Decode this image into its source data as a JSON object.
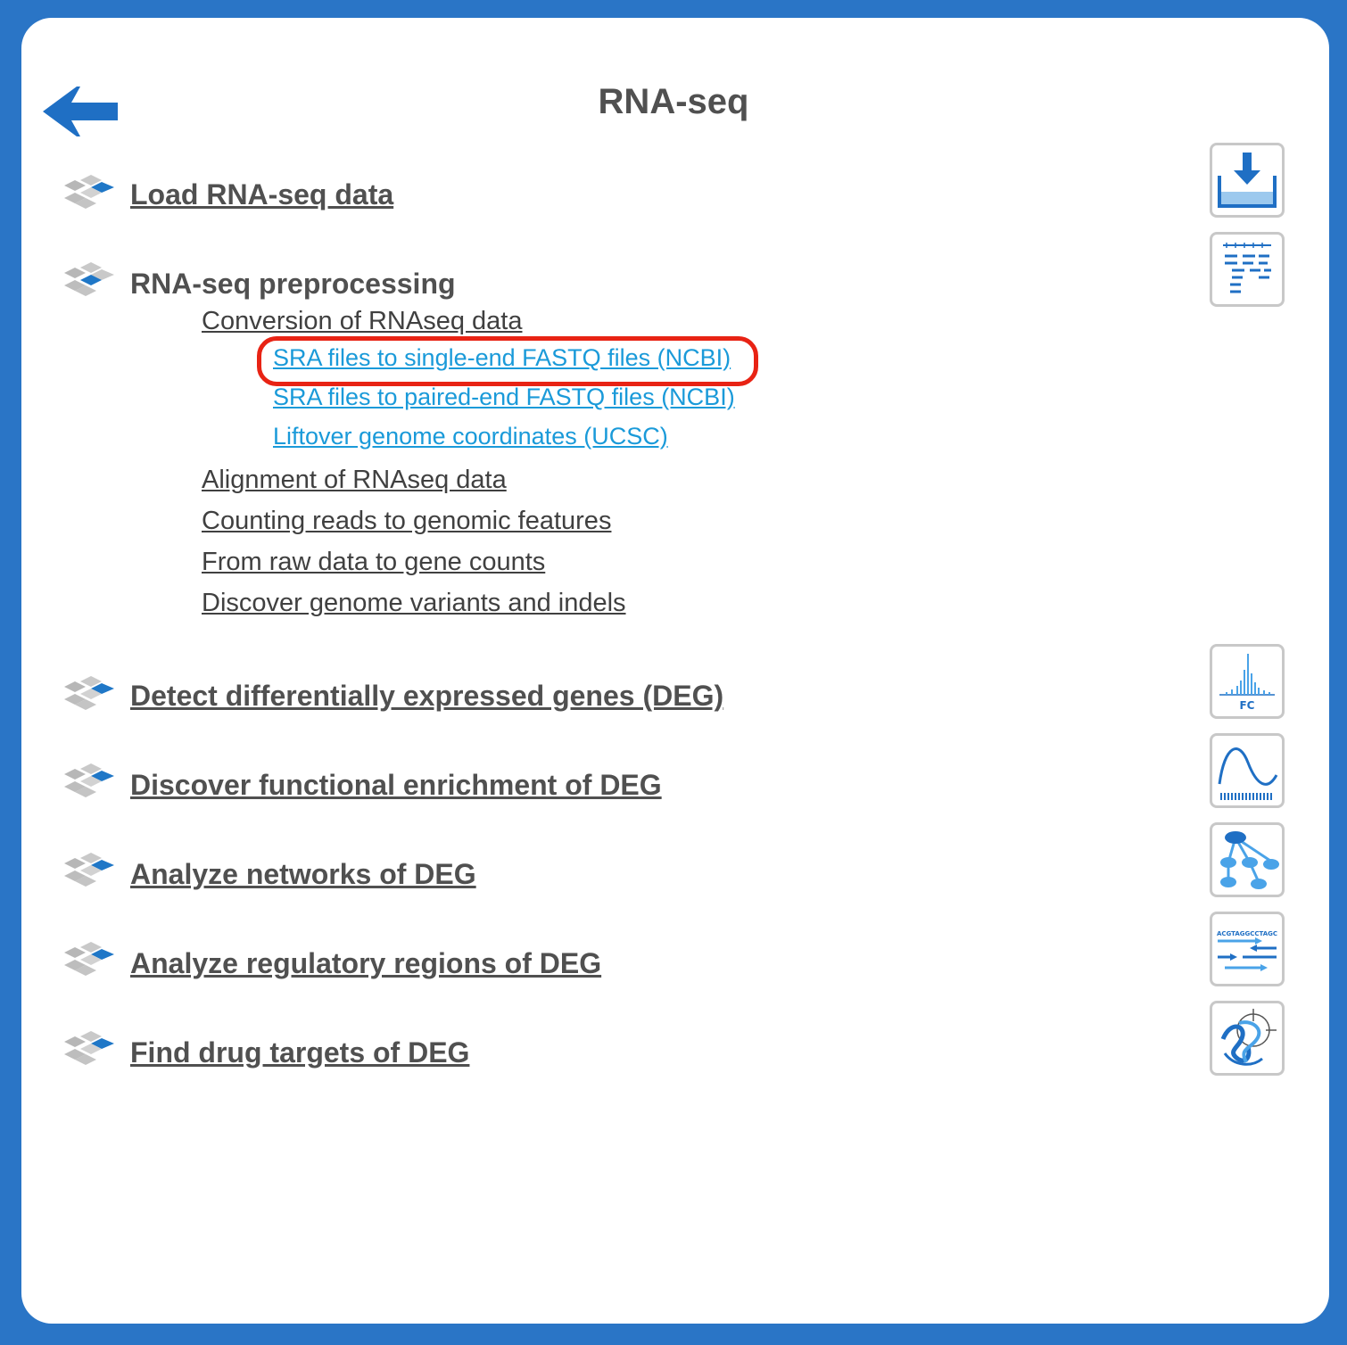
{
  "page": {
    "title": "RNA-seq"
  },
  "icons": {
    "back": "back-arrow-icon",
    "section": "stacked-squares-icon",
    "tools": [
      "download-icon",
      "alignment-icon",
      "fold-change-icon",
      "enrichment-curve-icon",
      "network-icon",
      "regulatory-sequence-icon",
      "drug-target-icon"
    ]
  },
  "colors": {
    "frame": "#2a75c6",
    "link_blue": "#1a9ad9",
    "highlight": "#e82314",
    "text": "#505050"
  },
  "sections": {
    "load": "Load RNA-seq data",
    "preprocessing": "RNA-seq preprocessing",
    "deg": "Detect differentially expressed genes (DEG)",
    "enrichment": "Discover functional enrichment of DEG",
    "networks": "Analyze networks of DEG",
    "regulatory": "Analyze regulatory regions of DEG",
    "drug": "Find drug targets of DEG"
  },
  "preprocessing": {
    "conversion": "Conversion of RNAseq data",
    "conversion_items": [
      "SRA files to single-end FASTQ files (NCBI)",
      "SRA files to paired-end FASTQ files (NCBI)",
      "Liftover genome coordinates (UCSC)"
    ],
    "alignment": "Alignment of RNAseq data",
    "counting": "Counting reads to genomic features",
    "raw_to_counts": "From raw data to gene counts",
    "variants": "Discover genome variants and indels"
  },
  "tool_labels": {
    "fold_change": "FC",
    "sequence": "ACGTAGGCCTAGC"
  }
}
